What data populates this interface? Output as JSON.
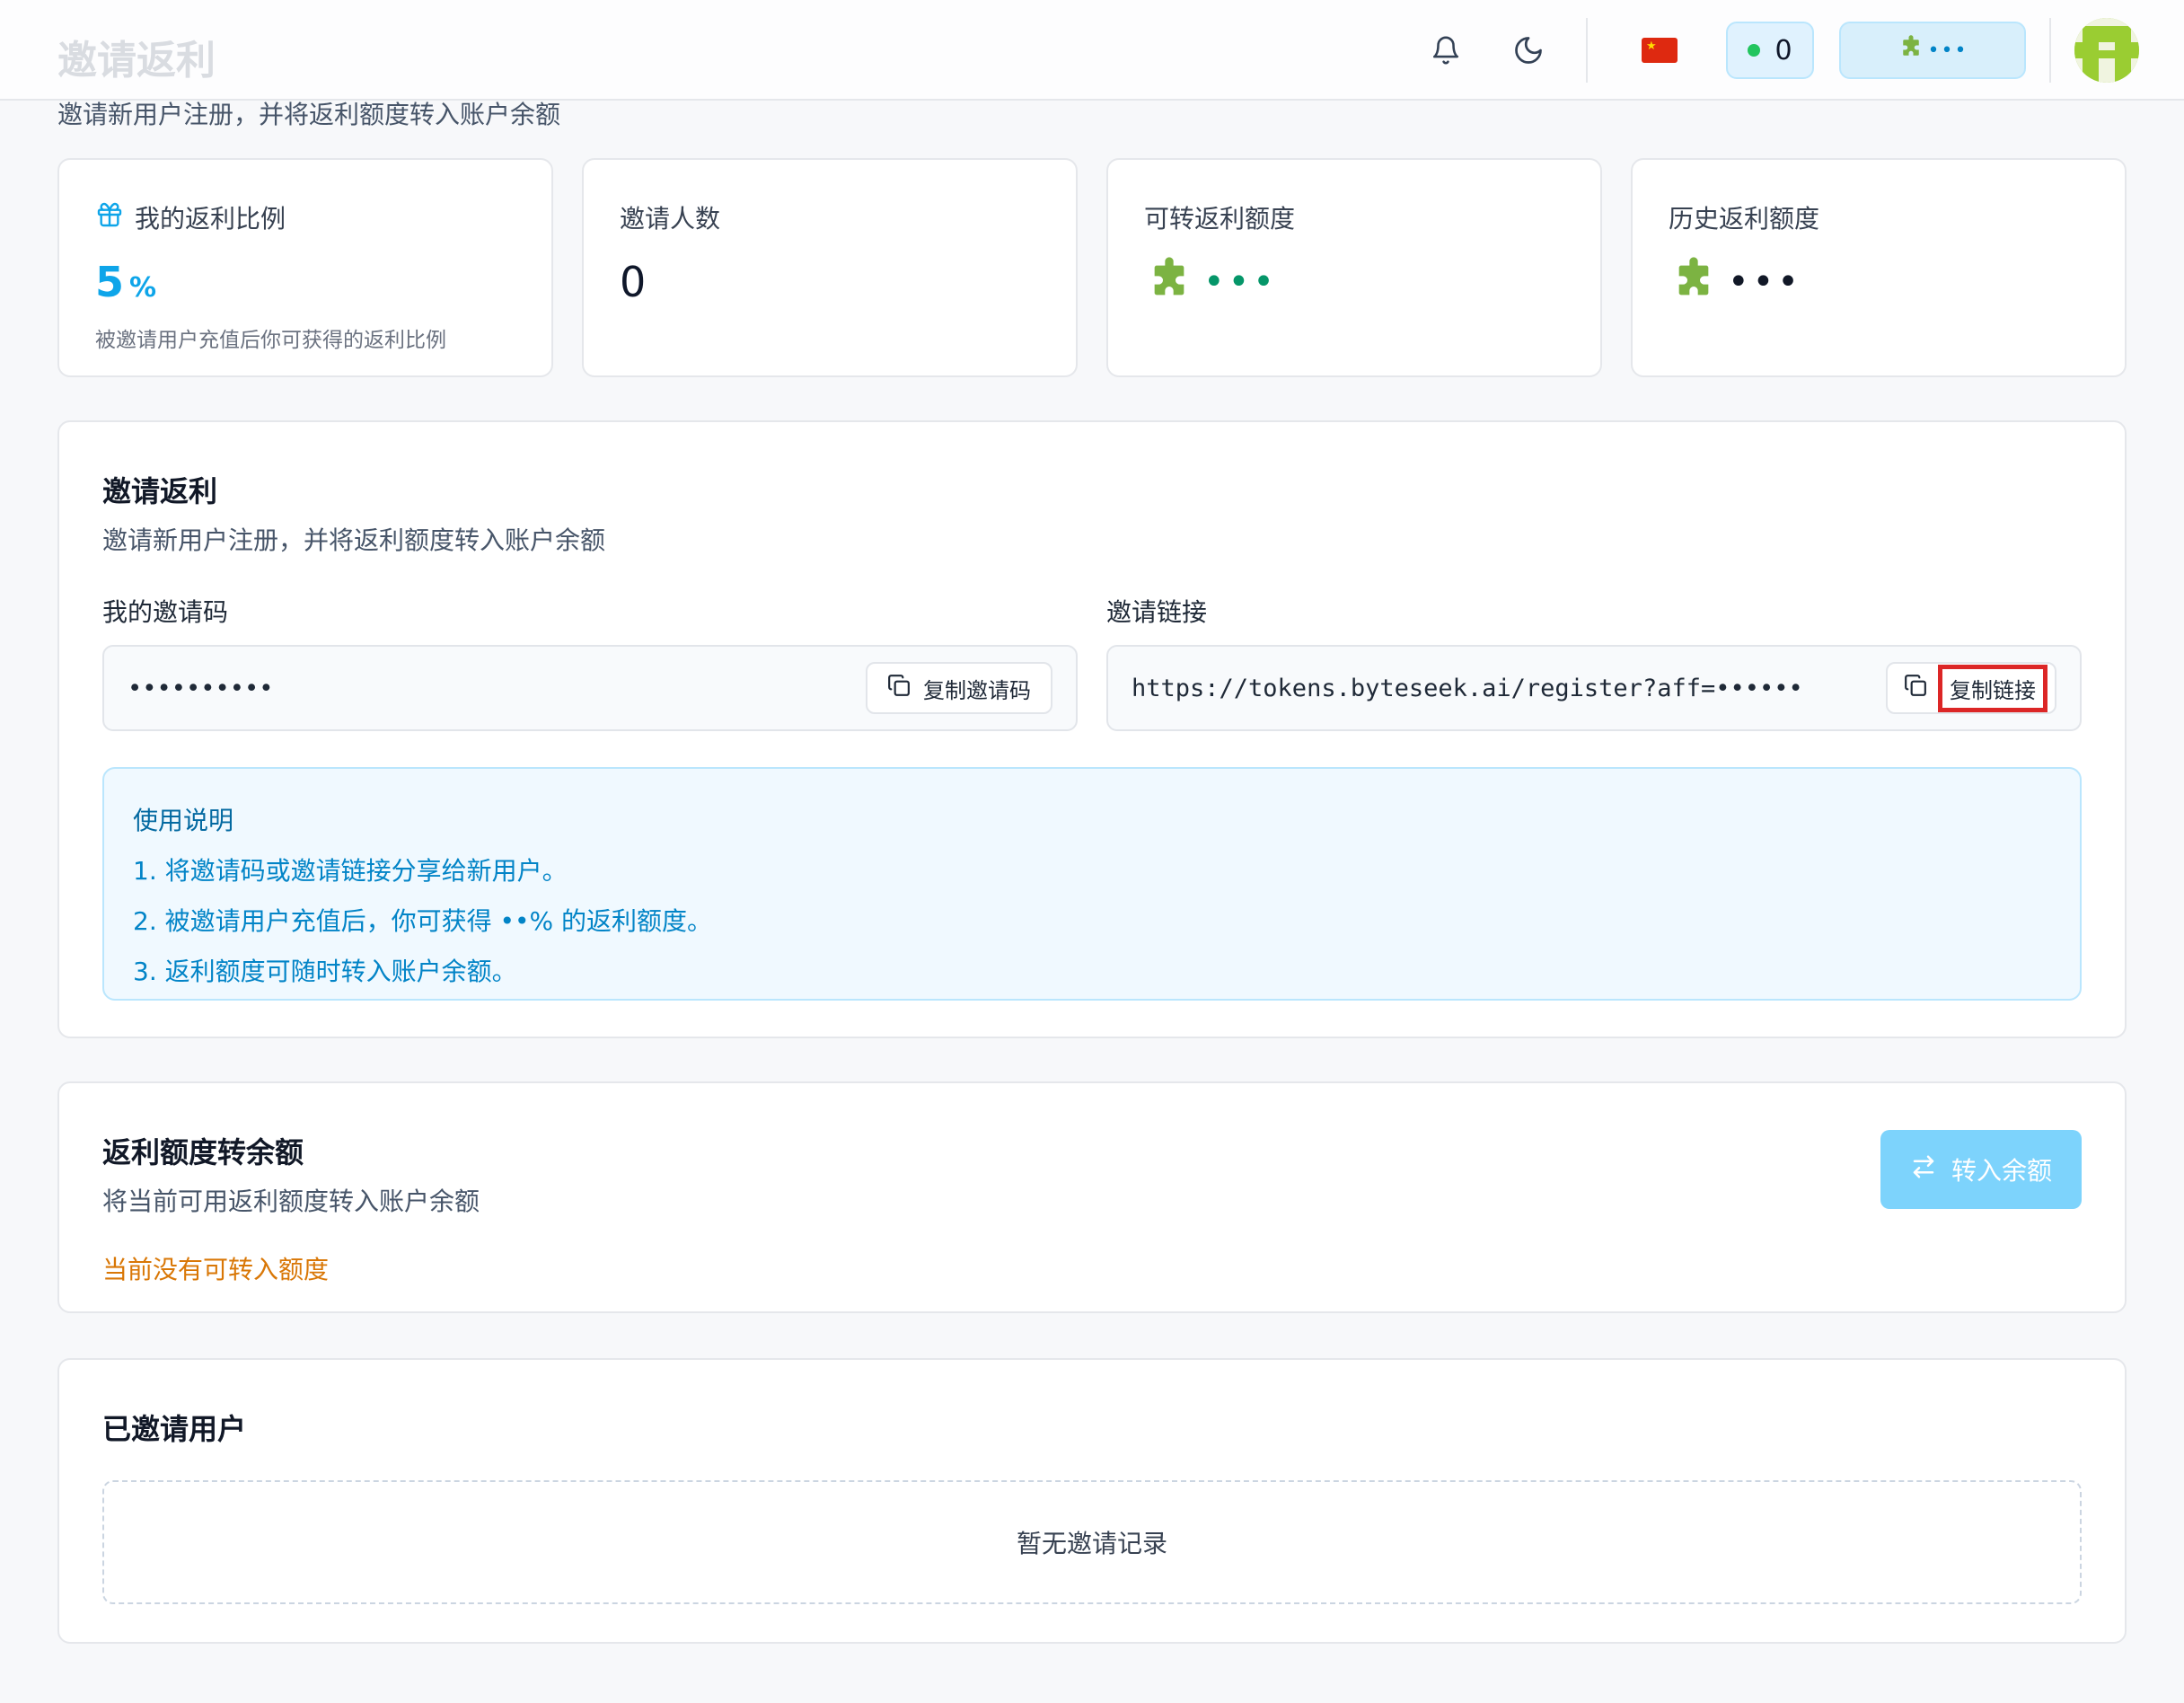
{
  "page": {
    "title": "邀请返利",
    "subtitle": "邀请新用户注册，并将返利额度转入账户余额"
  },
  "topbar": {
    "notification_icon": "bell-icon",
    "theme_icon": "moon-icon",
    "language_icon": "china-flag-icon",
    "status_count": "0",
    "balance_masked": "•••",
    "status_color": "#22c55e"
  },
  "stats": [
    {
      "label": "我的返利比例",
      "value": "5",
      "unit": "%",
      "desc": "被邀请用户充值后你可获得的返利比例",
      "icon": "gift-icon"
    },
    {
      "label": "邀请人数",
      "value": "0"
    },
    {
      "label": "可转返利额度",
      "value_masked": "•••",
      "icon": "puzzle-icon",
      "dot_color": "#059669"
    },
    {
      "label": "历史返利额度",
      "value_masked": "•••",
      "icon": "puzzle-icon",
      "dot_color": "#111827"
    }
  ],
  "invite": {
    "title": "邀请返利",
    "subtitle": "邀请新用户注册，并将返利额度转入账户余额",
    "code_label": "我的邀请码",
    "code_value": "••••••••••",
    "copy_code_label": "复制邀请码",
    "link_label": "邀请链接",
    "link_value": "https://tokens.byteseek.ai/register?aff=••••••",
    "copy_link_label": "复制链接",
    "guide_title": "使用说明",
    "guide_items": [
      "1. 将邀请码或邀请链接分享给新用户。",
      "2. 被邀请用户充值后，你可获得 ••% 的返利额度。",
      "3. 返利额度可随时转入账户余额。"
    ]
  },
  "transfer": {
    "title": "返利额度转余额",
    "subtitle": "将当前可用返利额度转入账户余额",
    "warning": "当前没有可转入额度",
    "button_label": "转入余额"
  },
  "invited": {
    "title": "已邀请用户",
    "empty": "暂无邀请记录"
  },
  "colors": {
    "accent": "#0ea5e9",
    "warning": "#d97706",
    "highlight": "#dc2626"
  }
}
